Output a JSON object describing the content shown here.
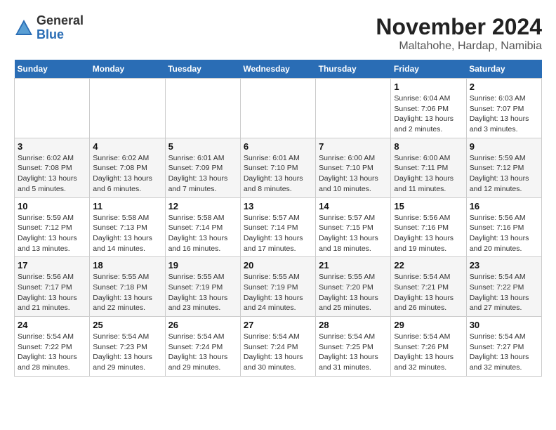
{
  "header": {
    "logo_general": "General",
    "logo_blue": "Blue",
    "title": "November 2024",
    "subtitle": "Maltahohe, Hardap, Namibia"
  },
  "weekdays": [
    "Sunday",
    "Monday",
    "Tuesday",
    "Wednesday",
    "Thursday",
    "Friday",
    "Saturday"
  ],
  "weeks": [
    [
      {
        "day": "",
        "info": ""
      },
      {
        "day": "",
        "info": ""
      },
      {
        "day": "",
        "info": ""
      },
      {
        "day": "",
        "info": ""
      },
      {
        "day": "",
        "info": ""
      },
      {
        "day": "1",
        "info": "Sunrise: 6:04 AM\nSunset: 7:06 PM\nDaylight: 13 hours and 2 minutes."
      },
      {
        "day": "2",
        "info": "Sunrise: 6:03 AM\nSunset: 7:07 PM\nDaylight: 13 hours and 3 minutes."
      }
    ],
    [
      {
        "day": "3",
        "info": "Sunrise: 6:02 AM\nSunset: 7:08 PM\nDaylight: 13 hours and 5 minutes."
      },
      {
        "day": "4",
        "info": "Sunrise: 6:02 AM\nSunset: 7:08 PM\nDaylight: 13 hours and 6 minutes."
      },
      {
        "day": "5",
        "info": "Sunrise: 6:01 AM\nSunset: 7:09 PM\nDaylight: 13 hours and 7 minutes."
      },
      {
        "day": "6",
        "info": "Sunrise: 6:01 AM\nSunset: 7:10 PM\nDaylight: 13 hours and 8 minutes."
      },
      {
        "day": "7",
        "info": "Sunrise: 6:00 AM\nSunset: 7:10 PM\nDaylight: 13 hours and 10 minutes."
      },
      {
        "day": "8",
        "info": "Sunrise: 6:00 AM\nSunset: 7:11 PM\nDaylight: 13 hours and 11 minutes."
      },
      {
        "day": "9",
        "info": "Sunrise: 5:59 AM\nSunset: 7:12 PM\nDaylight: 13 hours and 12 minutes."
      }
    ],
    [
      {
        "day": "10",
        "info": "Sunrise: 5:59 AM\nSunset: 7:12 PM\nDaylight: 13 hours and 13 minutes."
      },
      {
        "day": "11",
        "info": "Sunrise: 5:58 AM\nSunset: 7:13 PM\nDaylight: 13 hours and 14 minutes."
      },
      {
        "day": "12",
        "info": "Sunrise: 5:58 AM\nSunset: 7:14 PM\nDaylight: 13 hours and 16 minutes."
      },
      {
        "day": "13",
        "info": "Sunrise: 5:57 AM\nSunset: 7:14 PM\nDaylight: 13 hours and 17 minutes."
      },
      {
        "day": "14",
        "info": "Sunrise: 5:57 AM\nSunset: 7:15 PM\nDaylight: 13 hours and 18 minutes."
      },
      {
        "day": "15",
        "info": "Sunrise: 5:56 AM\nSunset: 7:16 PM\nDaylight: 13 hours and 19 minutes."
      },
      {
        "day": "16",
        "info": "Sunrise: 5:56 AM\nSunset: 7:16 PM\nDaylight: 13 hours and 20 minutes."
      }
    ],
    [
      {
        "day": "17",
        "info": "Sunrise: 5:56 AM\nSunset: 7:17 PM\nDaylight: 13 hours and 21 minutes."
      },
      {
        "day": "18",
        "info": "Sunrise: 5:55 AM\nSunset: 7:18 PM\nDaylight: 13 hours and 22 minutes."
      },
      {
        "day": "19",
        "info": "Sunrise: 5:55 AM\nSunset: 7:19 PM\nDaylight: 13 hours and 23 minutes."
      },
      {
        "day": "20",
        "info": "Sunrise: 5:55 AM\nSunset: 7:19 PM\nDaylight: 13 hours and 24 minutes."
      },
      {
        "day": "21",
        "info": "Sunrise: 5:55 AM\nSunset: 7:20 PM\nDaylight: 13 hours and 25 minutes."
      },
      {
        "day": "22",
        "info": "Sunrise: 5:54 AM\nSunset: 7:21 PM\nDaylight: 13 hours and 26 minutes."
      },
      {
        "day": "23",
        "info": "Sunrise: 5:54 AM\nSunset: 7:22 PM\nDaylight: 13 hours and 27 minutes."
      }
    ],
    [
      {
        "day": "24",
        "info": "Sunrise: 5:54 AM\nSunset: 7:22 PM\nDaylight: 13 hours and 28 minutes."
      },
      {
        "day": "25",
        "info": "Sunrise: 5:54 AM\nSunset: 7:23 PM\nDaylight: 13 hours and 29 minutes."
      },
      {
        "day": "26",
        "info": "Sunrise: 5:54 AM\nSunset: 7:24 PM\nDaylight: 13 hours and 29 minutes."
      },
      {
        "day": "27",
        "info": "Sunrise: 5:54 AM\nSunset: 7:24 PM\nDaylight: 13 hours and 30 minutes."
      },
      {
        "day": "28",
        "info": "Sunrise: 5:54 AM\nSunset: 7:25 PM\nDaylight: 13 hours and 31 minutes."
      },
      {
        "day": "29",
        "info": "Sunrise: 5:54 AM\nSunset: 7:26 PM\nDaylight: 13 hours and 32 minutes."
      },
      {
        "day": "30",
        "info": "Sunrise: 5:54 AM\nSunset: 7:27 PM\nDaylight: 13 hours and 32 minutes."
      }
    ]
  ]
}
